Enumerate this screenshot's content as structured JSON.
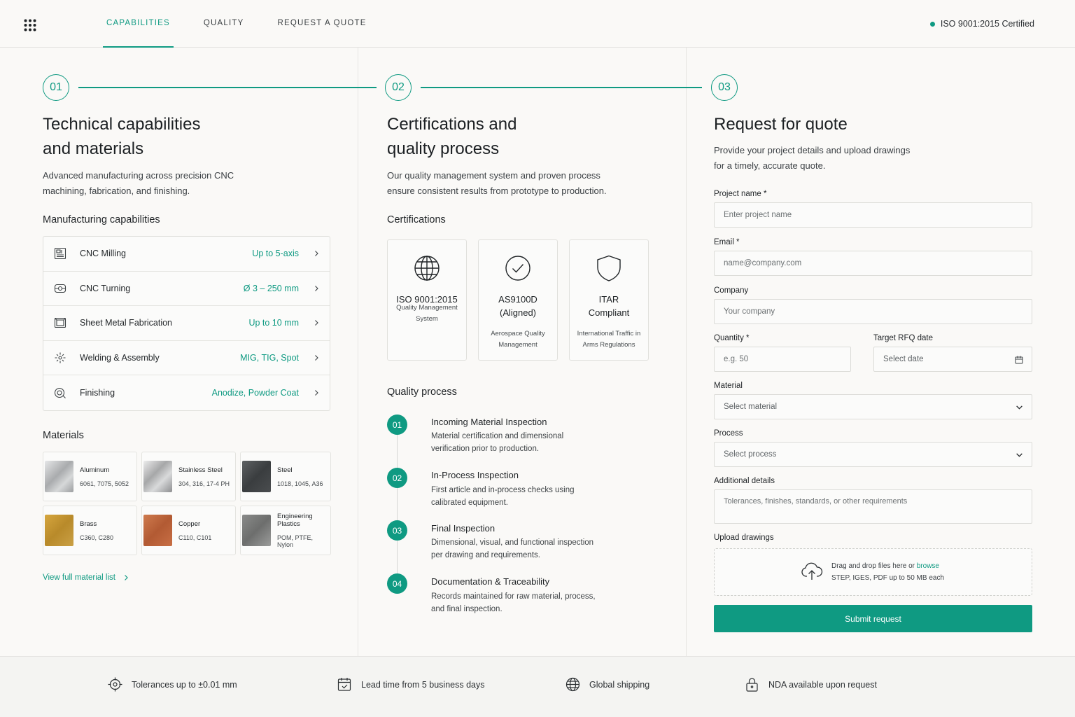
{
  "header": {
    "nav": [
      {
        "label": "CAPABILITIES",
        "active": true
      },
      {
        "label": "QUALITY",
        "active": false
      },
      {
        "label": "REQUEST A QUOTE",
        "active": false
      }
    ],
    "certified": "ISO 9001:2015 Certified"
  },
  "capabilities": {
    "step": "01",
    "title_line1": "Technical capabilities",
    "title_line2": "and materials",
    "desc_line1": "Advanced manufacturing across precision CNC",
    "desc_line2": "machining, fabrication, and finishing.",
    "list_title": "Manufacturing capabilities",
    "items": [
      {
        "label": "CNC Milling",
        "spec": "Up to 5-axis",
        "icon": "cnc-mill-icon"
      },
      {
        "label": "CNC Turning",
        "spec": "Ø 3 – 250 mm",
        "icon": "lathe-icon"
      },
      {
        "label": "Sheet Metal Fabrication",
        "spec": "Up to 10 mm",
        "icon": "sheet-metal-icon"
      },
      {
        "label": "Welding & Assembly",
        "spec": "MIG, TIG, Spot",
        "icon": "welding-icon"
      },
      {
        "label": "Finishing",
        "spec": "Anodize, Powder Coat",
        "icon": "finishing-icon"
      }
    ],
    "materials_title": "Materials",
    "materials": [
      {
        "name": "Aluminum",
        "grades": "6061, 7075, 5052"
      },
      {
        "name": "Stainless Steel",
        "grades": "304, 316, 17-4 PH"
      },
      {
        "name": "Steel",
        "grades": "1018, 1045, A36"
      },
      {
        "name": "Brass",
        "grades": "C360, C280"
      },
      {
        "name": "Copper",
        "grades": "C110, C101"
      },
      {
        "name": "Engineering Plastics",
        "grades": "POM, PTFE, Nylon"
      }
    ],
    "view_link": "View full material list"
  },
  "quality": {
    "step": "02",
    "title_line1": "Certifications and",
    "title_line2": "quality process",
    "desc_line1": "Our quality management system and proven process",
    "desc_line2": "ensure consistent results from prototype to production.",
    "cert_title": "Certifications",
    "certs": [
      {
        "name_line1": "ISO 9001:2015",
        "name_line2": "",
        "sub_line1": "Quality Management",
        "sub_line2": "System",
        "icon": "globe-icon"
      },
      {
        "name_line1": "AS9100D",
        "name_line2": "(Aligned)",
        "sub_line1": "Aerospace Quality",
        "sub_line2": "Management",
        "icon": "check-circle-icon"
      },
      {
        "name_line1": "ITAR",
        "name_line2": "Compliant",
        "sub_line1": "International Traffic in",
        "sub_line2": "Arms Regulations",
        "icon": "shield-icon"
      }
    ],
    "process_title": "Quality process",
    "steps": [
      {
        "num": "01",
        "title": "Incoming Material Inspection",
        "desc_line1": "Material certification and dimensional",
        "desc_line2": "verification prior to production."
      },
      {
        "num": "02",
        "title": "In-Process Inspection",
        "desc_line1": "First article and in-process checks using",
        "desc_line2": "calibrated equipment."
      },
      {
        "num": "03",
        "title": "Final Inspection",
        "desc_line1": "Dimensional, visual, and functional inspection",
        "desc_line2": "per drawing and requirements."
      },
      {
        "num": "04",
        "title": "Documentation & Traceability",
        "desc_line1": "Records maintained for raw material, process,",
        "desc_line2": "and final inspection."
      }
    ]
  },
  "quote": {
    "step": "03",
    "title": "Request for quote",
    "desc_line1": "Provide your project details and upload drawings",
    "desc_line2": "for a timely, accurate quote.",
    "fields": {
      "project_label": "Project name *",
      "project_placeholder": "Enter project name",
      "email_label": "Email *",
      "email_placeholder": "name@company.com",
      "company_label": "Company",
      "company_placeholder": "Your company",
      "quantity_label": "Quantity *",
      "quantity_placeholder": "e.g. 50",
      "date_label": "Target RFQ date",
      "date_placeholder": "Select date",
      "material_label": "Material",
      "material_value": "Select material",
      "process_label": "Process",
      "process_value": "Select process",
      "details_label": "Additional details",
      "details_placeholder": "Tolerances, finishes, standards, or other requirements",
      "upload_label": "Upload drawings",
      "upload_text": "Drag and drop files here or ",
      "upload_link": "browse",
      "upload_hint": "STEP, IGES, PDF up to 50 MB each"
    },
    "submit": "Submit request"
  },
  "footer": [
    {
      "text": "Tolerances up to ±0.01 mm",
      "icon": "crosshair-icon"
    },
    {
      "text": "Lead time from 5 business days",
      "icon": "calendar-check-icon"
    },
    {
      "text": "Global shipping",
      "icon": "globe-icon"
    },
    {
      "text": "NDA available upon request",
      "icon": "lock-icon"
    }
  ],
  "colors": {
    "accent": "#0f9a82",
    "background": "#faf9f7",
    "text": "#1f2326"
  }
}
